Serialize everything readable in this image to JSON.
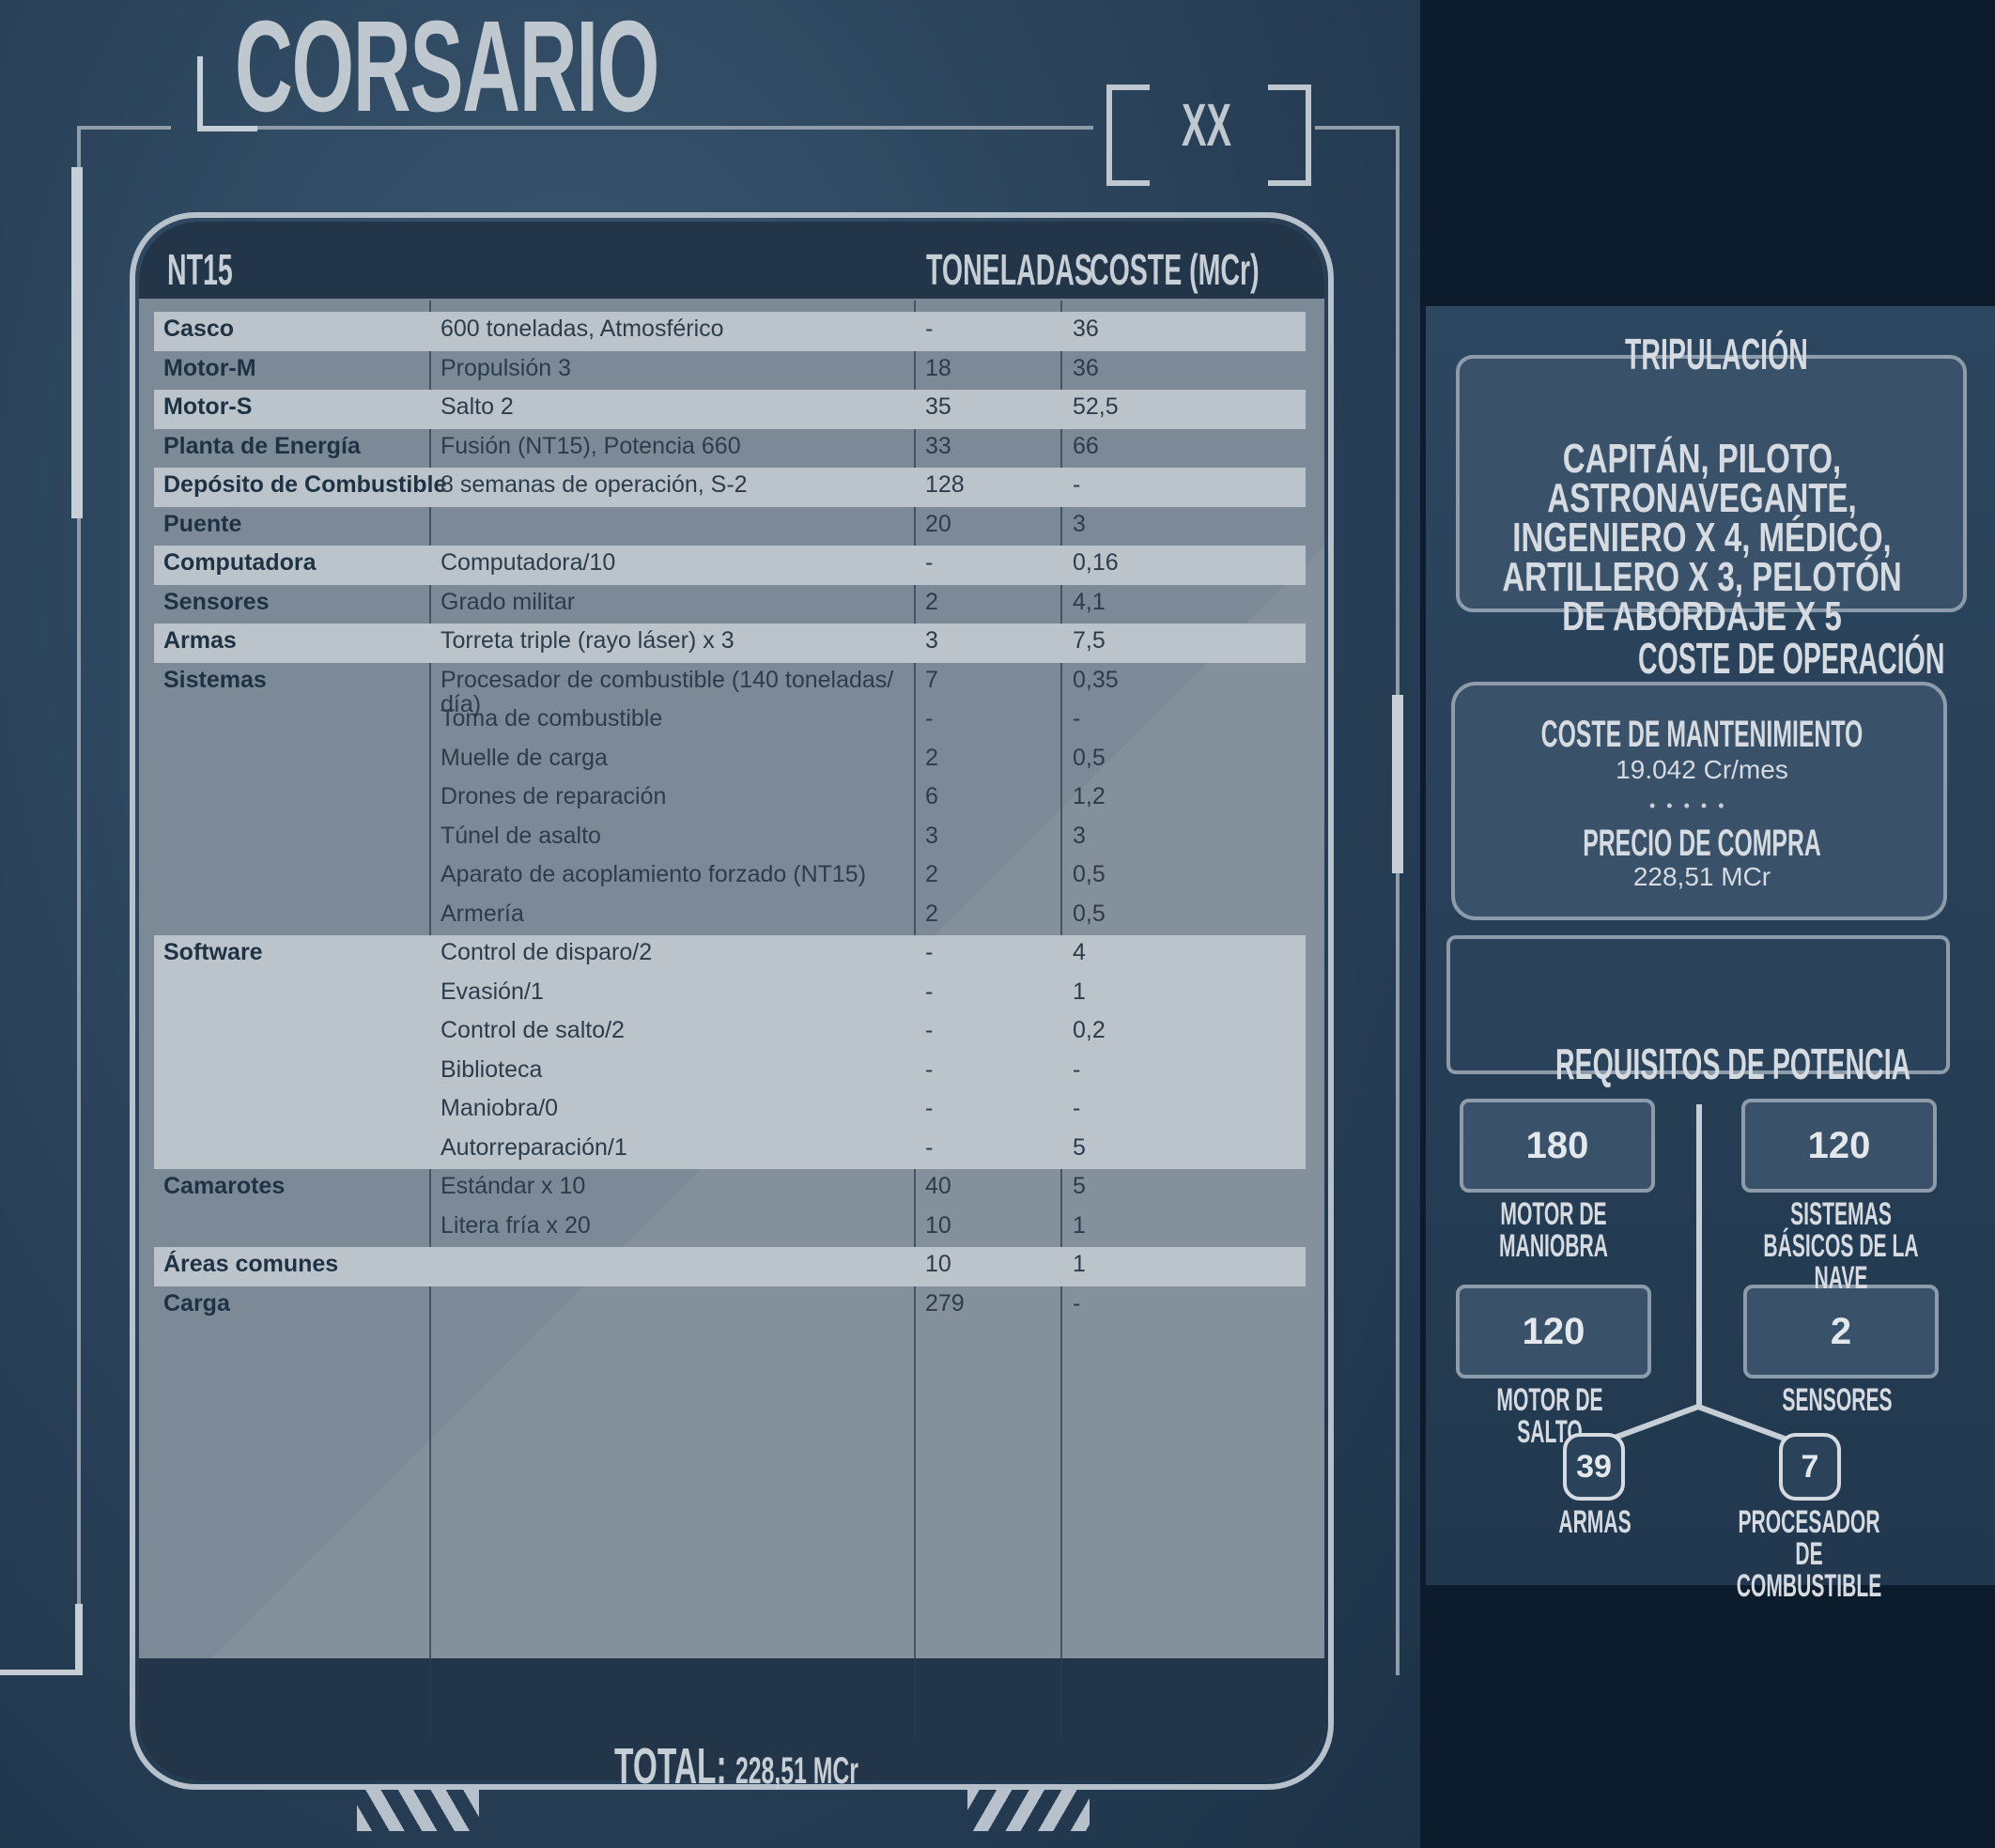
{
  "header": {
    "title": "CORSARIO",
    "tag": "XX"
  },
  "table": {
    "columns": [
      "NT15",
      "TONELADAS",
      "COSTE (MCr)"
    ],
    "rows": [
      {
        "label": "Casco",
        "desc": "600 toneladas, Atmosférico",
        "tons": "-",
        "cost": "36"
      },
      {
        "label": "Motor-M",
        "desc": "Propulsión 3",
        "tons": "18",
        "cost": "36"
      },
      {
        "label": "Motor-S",
        "desc": "Salto 2",
        "tons": "35",
        "cost": "52,5"
      },
      {
        "label": "Planta de Energía",
        "desc": "Fusión (NT15), Potencia 660",
        "tons": "33",
        "cost": "66"
      },
      {
        "label": "Depósito de Combustible",
        "desc": "8 semanas de operación, S-2",
        "tons": "128",
        "cost": "-"
      },
      {
        "label": "Puente",
        "desc": "",
        "tons": "20",
        "cost": "3"
      },
      {
        "label": "Computadora",
        "desc": "Computadora/10",
        "tons": "-",
        "cost": "0,16"
      },
      {
        "label": "Sensores",
        "desc": "Grado militar",
        "tons": "2",
        "cost": "4,1"
      },
      {
        "label": "Armas",
        "desc": "Torreta triple (rayo láser) x 3",
        "tons": "3",
        "cost": "7,5"
      },
      {
        "label": "Sistemas",
        "desc": "Procesador de combustible (140 toneladas/ día)",
        "tons": "7",
        "cost": "0,35"
      },
      {
        "label": "",
        "desc": "Toma de combustible",
        "tons": "-",
        "cost": "-"
      },
      {
        "label": "",
        "desc": "Muelle de carga",
        "tons": "2",
        "cost": "0,5"
      },
      {
        "label": "",
        "desc": "Drones de reparación",
        "tons": "6",
        "cost": "1,2"
      },
      {
        "label": "",
        "desc": "Túnel de asalto",
        "tons": "3",
        "cost": "3"
      },
      {
        "label": "",
        "desc": "Aparato de acoplamiento forzado (NT15)",
        "tons": "2",
        "cost": "0,5"
      },
      {
        "label": "",
        "desc": "Armería",
        "tons": "2",
        "cost": "0,5"
      },
      {
        "label": "Software",
        "desc": "Control de disparo/2",
        "tons": "-",
        "cost": "4"
      },
      {
        "label": "",
        "desc": "Evasión/1",
        "tons": "-",
        "cost": "1"
      },
      {
        "label": "",
        "desc": "Control de salto/2",
        "tons": "-",
        "cost": "0,2"
      },
      {
        "label": "",
        "desc": "Biblioteca",
        "tons": "-",
        "cost": "-"
      },
      {
        "label": "",
        "desc": "Maniobra/0",
        "tons": "-",
        "cost": "-"
      },
      {
        "label": "",
        "desc": "Autorreparación/1",
        "tons": "-",
        "cost": "5"
      },
      {
        "label": "Camarotes",
        "desc": "Estándar x 10",
        "tons": "40",
        "cost": "5"
      },
      {
        "label": "",
        "desc": "Litera fría x 20",
        "tons": "10",
        "cost": "1"
      },
      {
        "label": "Áreas comunes",
        "desc": "",
        "tons": "10",
        "cost": "1"
      },
      {
        "label": "Carga",
        "desc": "",
        "tons": "279",
        "cost": "-"
      }
    ],
    "total_label": "TOTAL:",
    "total_value": "228,51 MCr"
  },
  "crew": {
    "heading": "TRIPULACIÓN",
    "text": "CAPITÁN, PILOTO, ASTRONAVEGANTE, INGENIERO X 4, MÉDICO, ARTILLERO X 3, PELOTÓN DE ABORDAJE X 5"
  },
  "operation": {
    "heading": "COSTE DE OPERACIÓN",
    "maintenance_label": "COSTE DE MANTENIMIENTO",
    "maintenance_value": "19.042 Cr/mes",
    "purchase_label": "PRECIO DE COMPRA",
    "purchase_value": "228,51 MCr"
  },
  "power": {
    "heading": "REQUISITOS DE POTENCIA",
    "items": [
      {
        "value": "180",
        "label": "MOTOR DE MANIOBRA"
      },
      {
        "value": "120",
        "label": "SISTEMAS BÁSICOS DE LA NAVE"
      },
      {
        "value": "120",
        "label": "MOTOR DE SALTO"
      },
      {
        "value": "2",
        "label": "SENSORES"
      },
      {
        "value": "39",
        "label": "ARMAS"
      },
      {
        "value": "7",
        "label": "PROCESADOR DE COMBUSTIBLE"
      }
    ]
  }
}
